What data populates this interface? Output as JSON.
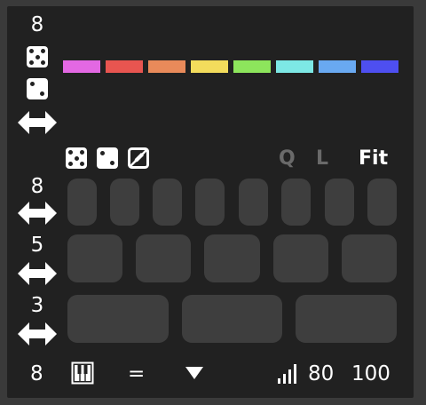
{
  "sections": {
    "top": {
      "count": "8"
    },
    "row1": {
      "count": "8"
    },
    "row2": {
      "count": "5"
    },
    "row3": {
      "count": "3"
    }
  },
  "palette": [
    "#e368e3",
    "#e85550",
    "#e98a5a",
    "#f3dc5c",
    "#8de55c",
    "#7de8e5",
    "#69a9f1",
    "#4e4ff0"
  ],
  "toolbar": {
    "q_label": "Q",
    "l_label": "L",
    "fit_label": "Fit",
    "inactive_color": "#6a6a6a",
    "active_color": "#ffffff"
  },
  "footer": {
    "count": "8",
    "equals": "=",
    "velocity_low": "80",
    "velocity_high": "100"
  },
  "icons": {
    "dice": "dice-five-icon",
    "die": "dice-two-icon",
    "swap": "double-arrow-icon",
    "no_edit": "pencil-crossed-icon",
    "piano": "piano-keys-icon",
    "dropdown": "triangle-down-icon",
    "signal": "signal-bars-icon"
  }
}
